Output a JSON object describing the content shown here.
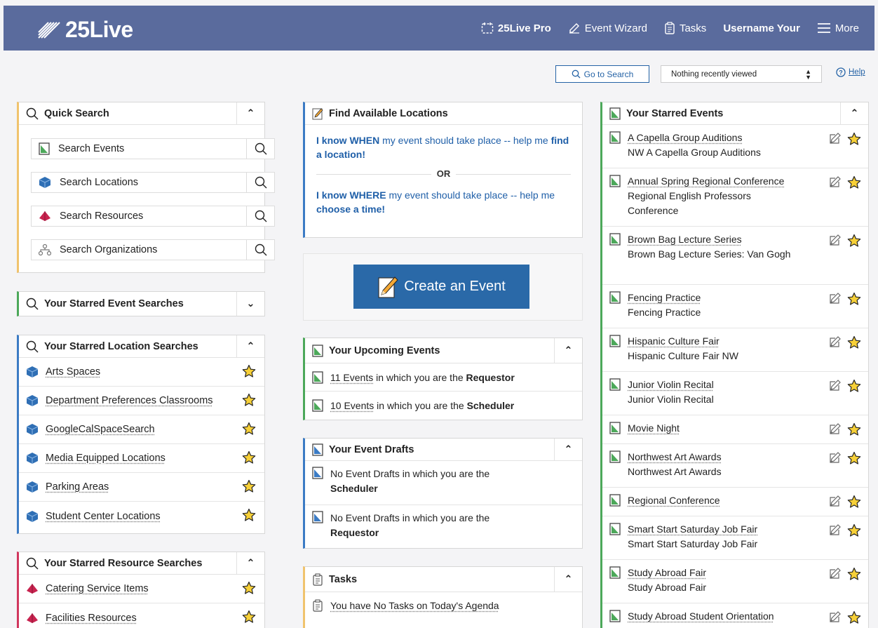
{
  "app": {
    "logo_text": "25Live",
    "colors": {
      "header": "#5a6b9d",
      "link": "#1f5fa8",
      "quick": "#f0c36d",
      "green": "#4ca85a",
      "blue": "#3b7bc4",
      "red": "#d1375e"
    }
  },
  "nav": {
    "pro": "25Live Pro",
    "wizard": "Event Wizard",
    "tasks": "Tasks",
    "user": "Username Your",
    "more": "More"
  },
  "toolbar": {
    "go_search": "Go to Search",
    "recent": "Nothing recently viewed",
    "help": "Help"
  },
  "quick_search": {
    "title": "Quick Search",
    "items": [
      {
        "label": "Search Events",
        "icon": "event-icon"
      },
      {
        "label": "Search Locations",
        "icon": "cube-icon"
      },
      {
        "label": "Search Resources",
        "icon": "pyramid-icon"
      },
      {
        "label": "Search Organizations",
        "icon": "org-icon"
      }
    ]
  },
  "starred_event_searches": {
    "title": "Your Starred Event Searches"
  },
  "starred_location_searches": {
    "title": "Your Starred Location Searches",
    "items": [
      "Arts Spaces",
      "Department Preferences Classrooms",
      "GoogleCalSpaceSearch",
      "Media Equipped Locations",
      "Parking Areas",
      "Student Center Locations"
    ]
  },
  "starred_resource_searches": {
    "title": "Your Starred Resource Searches",
    "items": [
      "Catering Service Items",
      "Facilities Resources"
    ]
  },
  "find_locations": {
    "title": "Find Available Locations",
    "when_bold": "I know WHEN",
    "when_mid": " my event should take place -- help me ",
    "when_link": "find a location!",
    "or": "OR",
    "where_bold": "I know WHERE",
    "where_mid": " my event should take place -- help me ",
    "where_link": "choose a time!"
  },
  "create_event": {
    "label": "Create an Event"
  },
  "upcoming": {
    "title": "Your Upcoming Events",
    "rows": [
      {
        "count": "11 Events",
        "mid": " in which you are the ",
        "role": "Requestor"
      },
      {
        "count": "10 Events",
        "mid": " in which you are the ",
        "role": "Scheduler"
      }
    ]
  },
  "drafts": {
    "title": "Your Event Drafts",
    "rows": [
      {
        "text": "No Event Drafts in which you are the",
        "role": "Scheduler"
      },
      {
        "text": "No Event Drafts in which you are the",
        "role": "Requestor"
      }
    ]
  },
  "tasks": {
    "title": "Tasks",
    "rows": [
      "You have No Tasks on Today's Agenda"
    ]
  },
  "starred_events": {
    "title": "Your Starred Events",
    "items": [
      {
        "name": "A Capella Group Auditions",
        "sub": "NW A Capella Group Auditions"
      },
      {
        "name": "Annual Spring Regional Conference",
        "sub": "Regional English Professors Conference"
      },
      {
        "name": "Brown Bag Lecture Series",
        "sub": "Brown Bag Lecture Series: Van Gogh"
      },
      {
        "name": "Fencing Practice",
        "sub": "Fencing Practice"
      },
      {
        "name": "Hispanic Culture Fair",
        "sub": "Hispanic Culture Fair NW"
      },
      {
        "name": "Junior Violin Recital",
        "sub": "Junior Violin Recital"
      },
      {
        "name": "Movie Night",
        "sub": ""
      },
      {
        "name": "Northwest Art Awards",
        "sub": "Northwest Art Awards"
      },
      {
        "name": "Regional Conference",
        "sub": ""
      },
      {
        "name": "Smart Start Saturday Job Fair",
        "sub": "Smart Start Saturday Job Fair"
      },
      {
        "name": "Study Abroad Fair",
        "sub": "Study Abroad Fair"
      },
      {
        "name": "Study Abroad Student Orientation",
        "sub": ""
      }
    ]
  }
}
